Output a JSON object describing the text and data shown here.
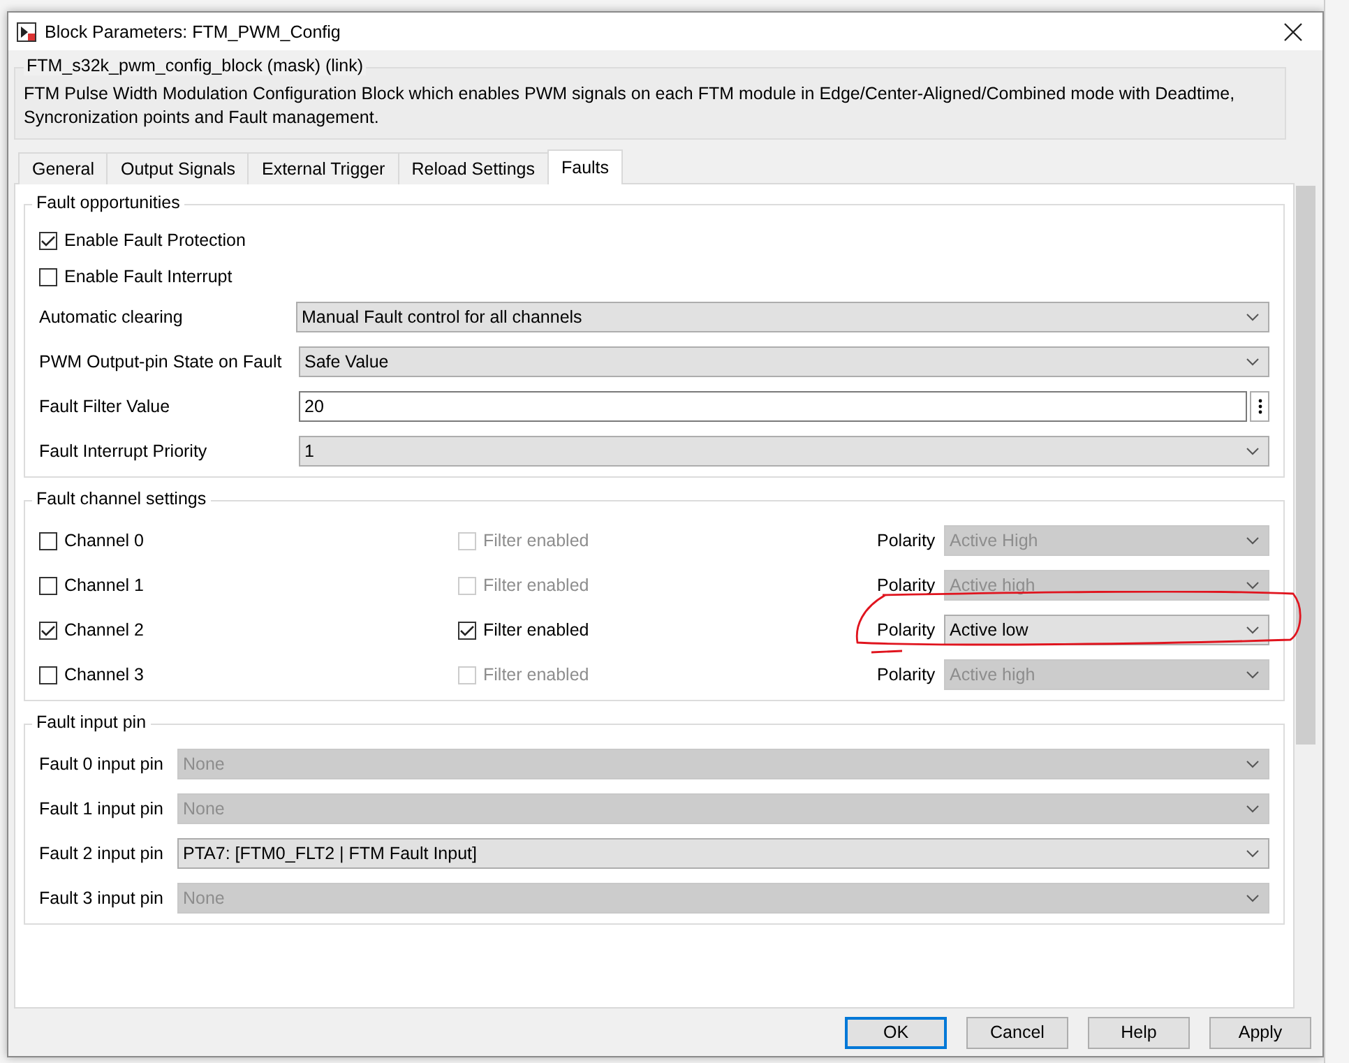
{
  "window": {
    "title": "Block Parameters: FTM_PWM_Config"
  },
  "mask": {
    "legend": "FTM_s32k_pwm_config_block (mask) (link)",
    "description": "FTM Pulse Width Modulation Configuration Block which enables PWM signals on each FTM module in Edge/Center-Aligned/Combined mode with Deadtime, Syncronization points and Fault management."
  },
  "tabs": [
    {
      "label": "General",
      "selected": false
    },
    {
      "label": "Output Signals",
      "selected": false
    },
    {
      "label": "External Trigger",
      "selected": false
    },
    {
      "label": "Reload Settings",
      "selected": false
    },
    {
      "label": "Faults",
      "selected": true
    }
  ],
  "fault_opportunities": {
    "legend": "Fault opportunities",
    "checks": [
      {
        "label": "Enable Fault Protection",
        "checked": true
      },
      {
        "label": "Enable Fault Interrupt",
        "checked": false
      }
    ],
    "fields": [
      {
        "label": "Automatic clearing",
        "kind": "select",
        "value": "Manual Fault control for all channels"
      },
      {
        "label": "PWM Output-pin State on Fault",
        "kind": "select",
        "value": "Safe Value"
      },
      {
        "label": "Fault Filter Value",
        "kind": "text",
        "value": "20"
      },
      {
        "label": "Fault Interrupt Priority",
        "kind": "select",
        "value": "1"
      }
    ]
  },
  "fault_channels": {
    "legend": "Fault channel settings",
    "rows": [
      {
        "label": "Channel 0",
        "checked": false,
        "filter_label": "Filter enabled",
        "filter_checked": false,
        "filter_disabled": true,
        "polarity_label": "Polarity",
        "polarity": "Active High",
        "polarity_disabled": true,
        "highlighted": false
      },
      {
        "label": "Channel 1",
        "checked": false,
        "filter_label": "Filter enabled",
        "filter_checked": false,
        "filter_disabled": true,
        "polarity_label": "Polarity",
        "polarity": "Active high",
        "polarity_disabled": true,
        "highlighted": false
      },
      {
        "label": "Channel 2",
        "checked": true,
        "filter_label": "Filter enabled",
        "filter_checked": true,
        "filter_disabled": false,
        "polarity_label": "Polarity",
        "polarity": "Active low",
        "polarity_disabled": false,
        "highlighted": true
      },
      {
        "label": "Channel 3",
        "checked": false,
        "filter_label": "Filter enabled",
        "filter_checked": false,
        "filter_disabled": true,
        "polarity_label": "Polarity",
        "polarity": "Active high",
        "polarity_disabled": true,
        "highlighted": false
      }
    ]
  },
  "fault_input_pins": {
    "legend": "Fault input pin",
    "rows": [
      {
        "label": "Fault 0 input pin",
        "value": "None",
        "disabled": true
      },
      {
        "label": "Fault 1 input pin",
        "value": "None",
        "disabled": true
      },
      {
        "label": "Fault 2 input pin",
        "value": "PTA7: [FTM0_FLT2 | FTM Fault Input]",
        "disabled": false
      },
      {
        "label": "Fault 3 input pin",
        "value": "None",
        "disabled": true
      }
    ]
  },
  "buttons": [
    {
      "label": "OK",
      "focused": true
    },
    {
      "label": "Cancel",
      "focused": false
    },
    {
      "label": "Help",
      "focused": false
    },
    {
      "label": "Apply",
      "focused": false
    }
  ]
}
